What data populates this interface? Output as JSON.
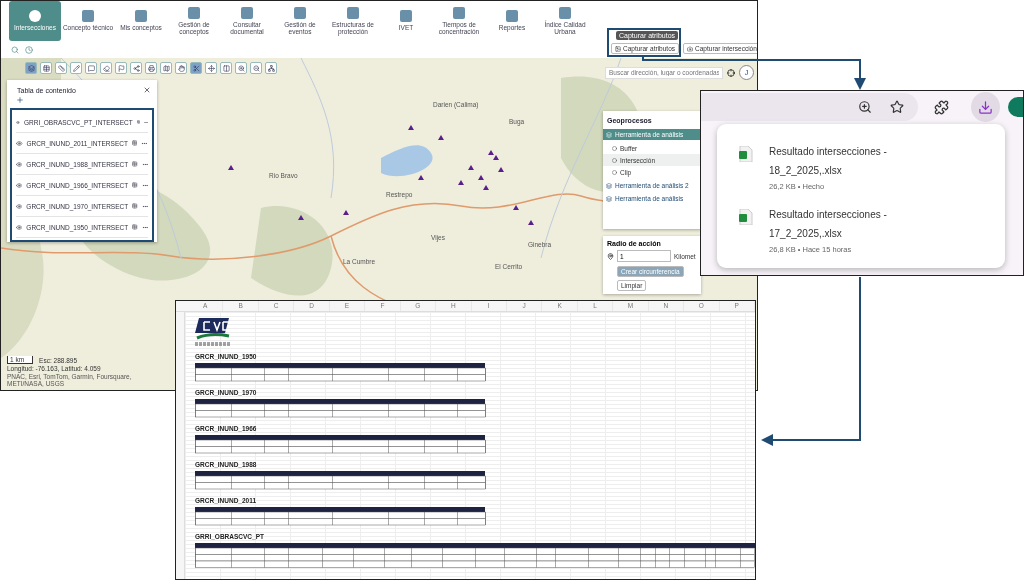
{
  "map_app": {
    "nav": [
      {
        "label": "Intersecciones",
        "selected": true
      },
      {
        "label": "Concepto técnico",
        "selected": false
      },
      {
        "label": "Mis conceptos",
        "selected": false
      },
      {
        "label": "Gestión de conceptos",
        "selected": false
      },
      {
        "label": "Consultar documental",
        "selected": false
      },
      {
        "label": "Gestión de eventos",
        "selected": false
      },
      {
        "label": "Estructuras de protección",
        "selected": false
      },
      {
        "label": "IVET",
        "selected": false
      },
      {
        "label": "Tiempos de concentración",
        "selected": false
      },
      {
        "label": "Reportes",
        "selected": false
      },
      {
        "label": "Índice Calidad Urbana",
        "selected": false
      }
    ],
    "tooltip": "Capturar atributos",
    "capture_buttons": [
      "Capturar atributos",
      "Capturar intersección"
    ],
    "search": {
      "placeholder": "Buscar dirección, lugar o coordenadas"
    },
    "user_initial": "J",
    "map_tools": [
      {
        "selected": true
      },
      {
        "selected": false
      },
      {
        "selected": false
      },
      {
        "selected": false
      },
      {
        "selected": false
      },
      {
        "selected": false
      },
      {
        "selected": false
      },
      {
        "selected": false
      },
      {
        "selected": false
      },
      {
        "selected": false
      },
      {
        "selected": false
      },
      {
        "selected": true
      },
      {
        "selected": false
      },
      {
        "selected": false
      },
      {
        "selected": false
      },
      {
        "selected": false
      },
      {
        "selected": false
      }
    ],
    "toc": {
      "title": "Tabla de contenido",
      "layers": [
        "GRRI_OBRASCVC_PT_INTERSECT",
        "GRCR_INUND_2011_INTERSECT",
        "GRCR_INUND_1988_INTERSECT",
        "GRCR_INUND_1966_INTERSECT",
        "GRCR_INUND_1970_INTERSECT",
        "GRCR_INUND_1950_INTERSECT"
      ]
    },
    "places": [
      "Darien (Calima)",
      "Buga",
      "Restrepo",
      "Vijes",
      "El Cerrito",
      "La Cumbre",
      "Ginebra",
      "Rio Bravo"
    ],
    "geoprocesos": {
      "title": "Geoprocesos",
      "groups": [
        {
          "label": "Herramienta de análisis",
          "expanded": true,
          "children": [
            {
              "label": "Buffer",
              "selected": false
            },
            {
              "label": "Intersección",
              "selected": true
            },
            {
              "label": "Clip",
              "selected": false
            }
          ]
        },
        {
          "label": "Herramienta de análisis 2",
          "expanded": false
        },
        {
          "label": "Herramienta de análisis",
          "expanded": false
        }
      ]
    },
    "radius": {
      "title": "Radio de acción",
      "value": "1",
      "unit": "Kilomet",
      "buttons": [
        "Crear circunferencia",
        "Limpiar"
      ]
    },
    "scale": "1 km",
    "scale_text": "Esc: 288.895",
    "coords": "Longitud: -76.163, Latitud: 4.059",
    "attribution": "PNAC, Esri, TomTom, Garmin, Foursquare, METI/NASA, USGS"
  },
  "downloads": {
    "items": [
      {
        "name": "Resultado intersecciones - 18_2_2025,.xlsx",
        "meta": "26,2 KB • Hecho"
      },
      {
        "name": "Resultado intersecciones - 17_2_2025,.xlsx",
        "meta": "26,8 KB • Hace 15 horas"
      }
    ]
  },
  "spreadsheet": {
    "columns": [
      "A",
      "B",
      "C",
      "D",
      "E",
      "F",
      "G",
      "H",
      "I",
      "J",
      "K",
      "L",
      "M",
      "N",
      "O",
      "P"
    ],
    "sections": [
      {
        "title": "GRCR_INUND_1950",
        "kind": "narrow"
      },
      {
        "title": "GRCR_INUND_1970",
        "kind": "narrow"
      },
      {
        "title": "GRCR_INUND_1966",
        "kind": "narrow"
      },
      {
        "title": "GRCR_INUND_1988",
        "kind": "narrow"
      },
      {
        "title": "GRCR_INUND_2011",
        "kind": "narrow"
      },
      {
        "title": "GRRI_OBRASCVC_PT",
        "kind": "wide"
      }
    ]
  }
}
